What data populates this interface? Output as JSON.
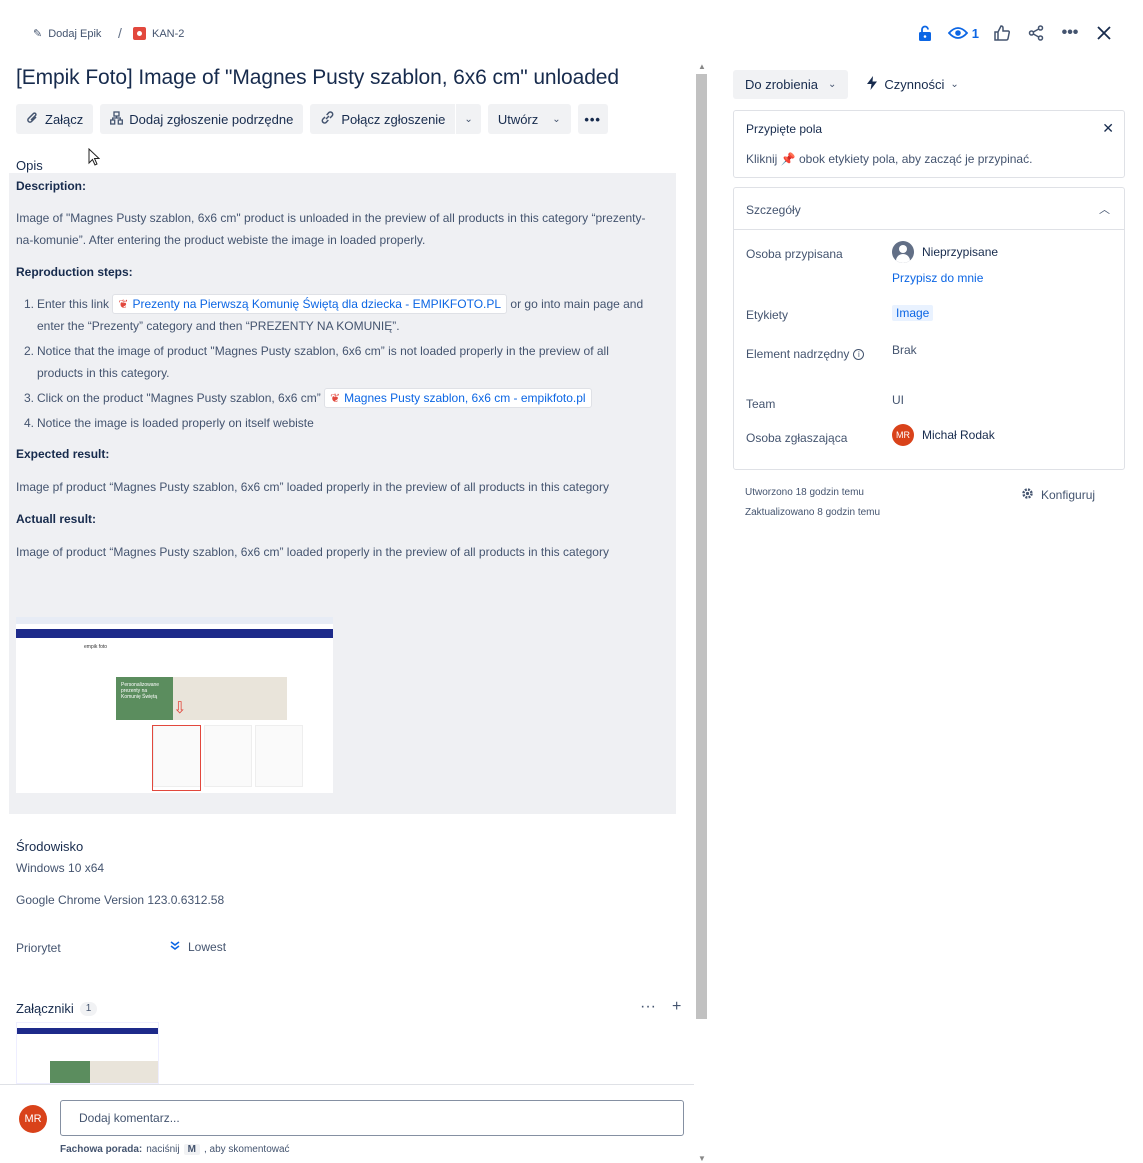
{
  "breadcrumb": {
    "epic_label": "Dodaj Epik",
    "separator": "/",
    "issue_key": "KAN-2"
  },
  "top_actions": {
    "watch_count": "1"
  },
  "issue": {
    "title": "[Empik Foto] Image of \"Magnes Pusty szablon, 6x6 cm\" unloaded"
  },
  "toolbar": {
    "attach": "Załącz",
    "add_child": "Dodaj zgłoszenie podrzędne",
    "link_issue": "Połącz zgłoszenie",
    "create": "Utwórz"
  },
  "description": {
    "label": "Opis",
    "h_description": "Description:",
    "p1": "Image of \"Magnes Pusty szablon, 6x6 cm\" product is unloaded in the preview of all products in this category “prezenty-na-komunie”. After entering the product webiste the image in loaded properly.",
    "h_repro": "Reproduction steps:",
    "steps": [
      {
        "num": "1.",
        "pre": "Enter this link",
        "link": "Prezenty na Pierwszą Komunię Świętą dla dziecka - EMPIKFOTO.PL",
        "post": "or go into main page and enter the “Prezenty” category and then “PREZENTY NA KOMUNIĘ”."
      },
      {
        "num": "2.",
        "text": "Notice that the image of product \"Magnes Pusty szablon, 6x6 cm” is not loaded properly in the preview of all products in this category."
      },
      {
        "num": "3.",
        "pre": "Click on the product \"Magnes Pusty szablon, 6x6 cm”",
        "link": "Magnes Pusty szablon, 6x6 cm - empikfoto.pl"
      },
      {
        "num": "4.",
        "text": "Notice the image is loaded properly on itself webiste"
      }
    ],
    "h_expected": "Expected result:",
    "expected": "Image pf product “Magnes Pusty szablon, 6x6 cm” loaded properly in the preview of all products in this category",
    "h_actual": "Actuall result:",
    "actual": "Image of product “Magnes Pusty szablon, 6x6 cm” loaded properly in the preview of all products in this category"
  },
  "environment": {
    "label": "Środowisko",
    "line1": "Windows 10 x64",
    "line2": "Google Chrome Version 123.0.6312.58"
  },
  "priority": {
    "label": "Priorytet",
    "value": "Lowest"
  },
  "attachments": {
    "label": "Załączniki",
    "count": "1"
  },
  "comment": {
    "avatar_initials": "MR",
    "placeholder": "Dodaj komentarz...",
    "tip_bold": "Fachowa porada:",
    "tip_pre": "naciśnij",
    "tip_key": "M",
    "tip_post": ", aby skomentować"
  },
  "sidebar": {
    "status": "Do zrobienia",
    "actions": "Czynności",
    "pinned": {
      "title": "Przypięte pola",
      "text_pre": "Kliknij",
      "text_post": "obok etykiety pola, aby zacząć je przypinać."
    },
    "details": {
      "title": "Szczegóły",
      "assignee_label": "Osoba przypisana",
      "assignee_value": "Nieprzypisane",
      "assign_me": "Przypisz do mnie",
      "labels_label": "Etykiety",
      "labels_value": "Image",
      "parent_label": "Element nadrzędny",
      "parent_value": "Brak",
      "team_label": "Team",
      "team_value": "UI",
      "reporter_label": "Osoba zgłaszająca",
      "reporter_initials": "MR",
      "reporter_value": "Michał Rodak"
    },
    "created": "Utworzono 18 godzin temu",
    "updated": "Zaktualizowano 8 godzin temu",
    "configure": "Konfiguruj"
  },
  "colors": {
    "accent": "#0c66e4",
    "avatar": "#d9421a",
    "description_bg": "#eff0f3",
    "issue_type": "#e2483d"
  },
  "icons": [
    "pencil-icon",
    "bug-icon",
    "lock-open-icon",
    "eye-icon",
    "thumbs-up-icon",
    "share-icon",
    "more-icon",
    "close-icon",
    "paperclip-icon",
    "hierarchy-icon",
    "link-icon",
    "chevron-down-icon",
    "bolt-icon",
    "pin-icon",
    "info-icon",
    "gear-icon",
    "plus-icon",
    "priority-lowest-icon"
  ]
}
